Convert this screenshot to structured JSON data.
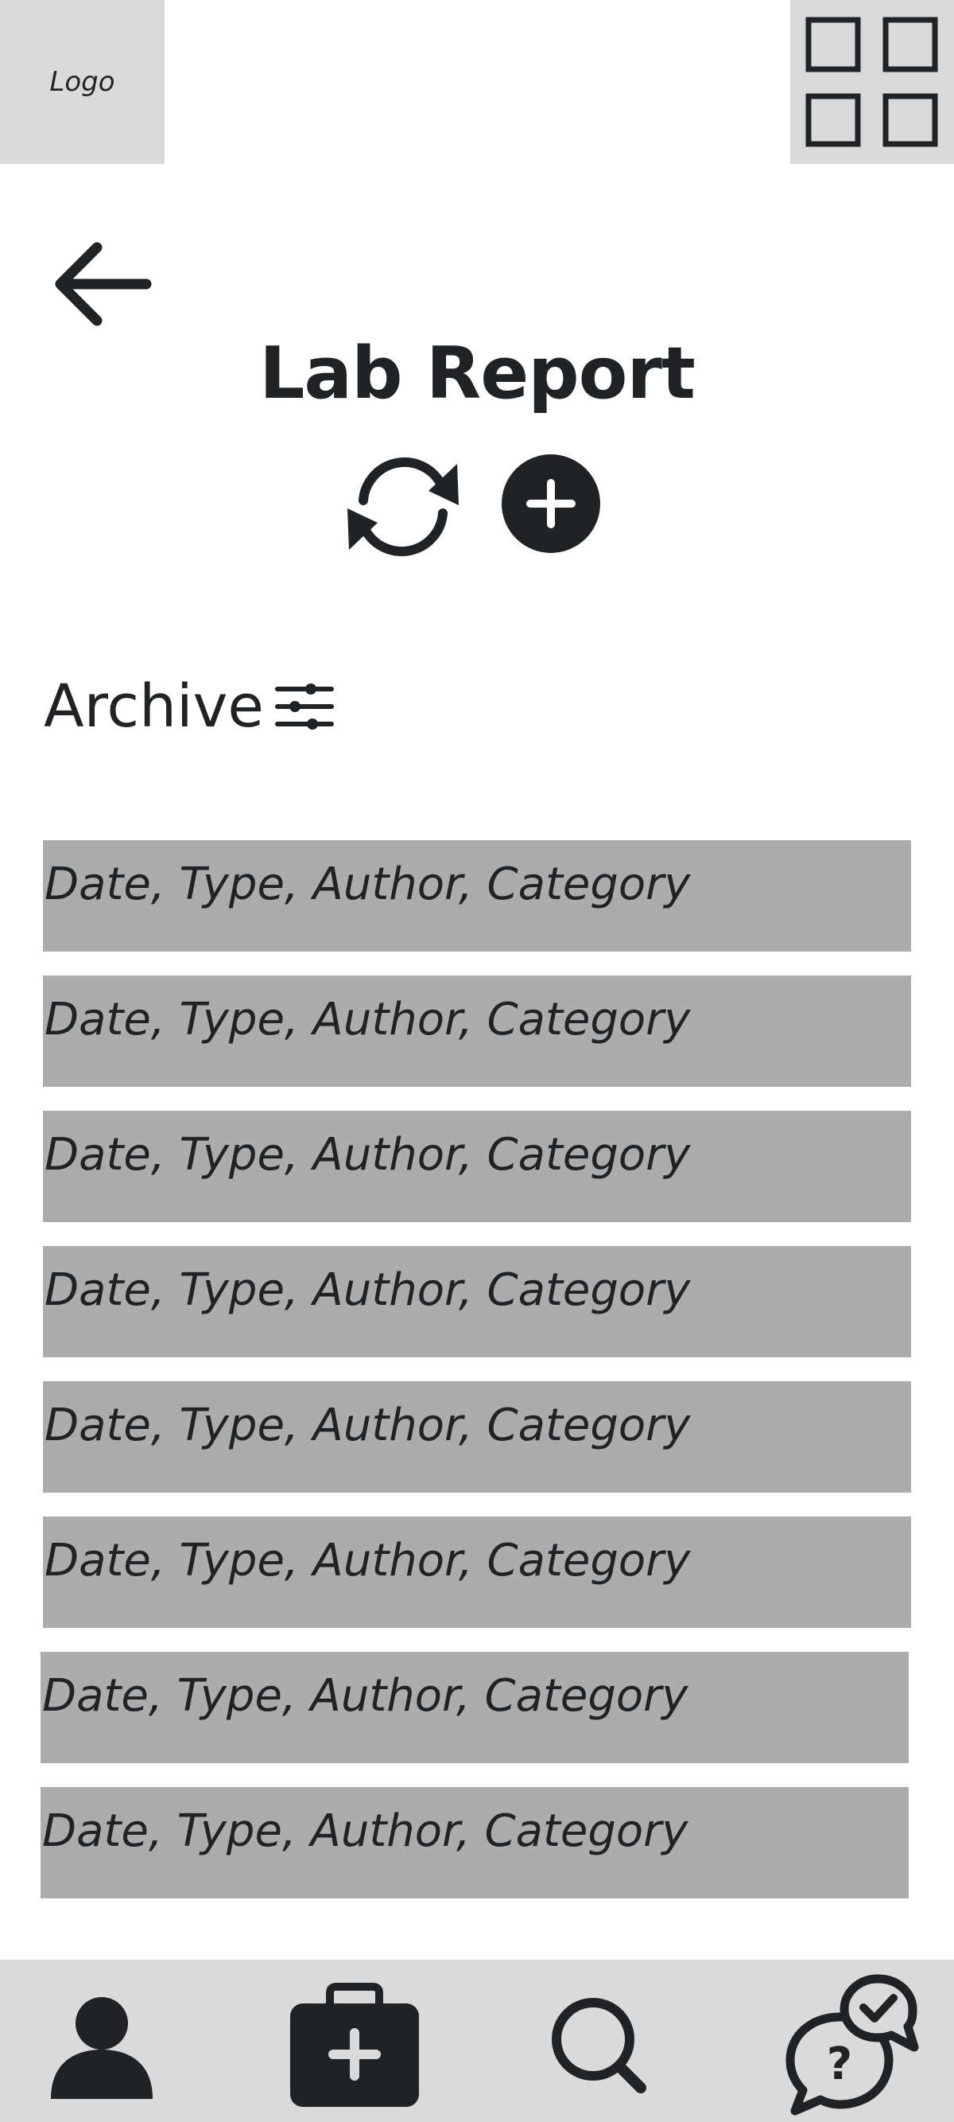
{
  "header": {
    "logo_text": "Logo",
    "title": "Lab Report"
  },
  "icons": {
    "apps": "grid-icon",
    "back": "arrow-left-icon",
    "refresh": "refresh-icon",
    "add": "plus-circle-icon",
    "filter": "sliders-icon",
    "nav_profile": "person-icon",
    "nav_medical": "medical-kit-icon",
    "nav_search": "search-icon",
    "nav_support": "chat-question-icon"
  },
  "archive": {
    "label": "Archive",
    "rows": [
      "Date, Type, Author, Category",
      "Date, Type, Author, Category",
      "Date, Type, Author, Category",
      "Date, Type, Author, Category",
      "Date, Type, Author, Category",
      "Date, Type, Author, Category",
      "Date, Type, Author, Category",
      "Date, Type, Author, Category"
    ]
  },
  "colors": {
    "bar_gray": "#dadada",
    "row_gray": "#acacac",
    "ink": "#1f2326"
  }
}
